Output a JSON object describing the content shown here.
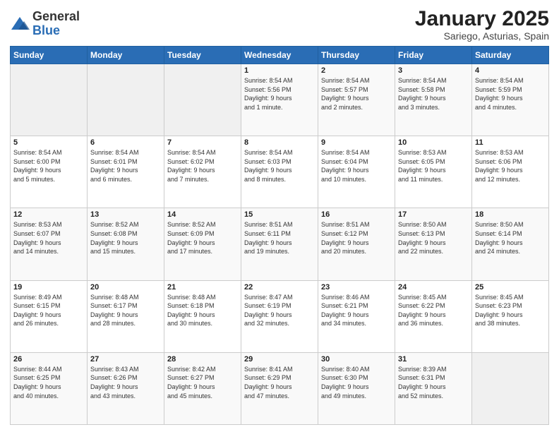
{
  "logo": {
    "general": "General",
    "blue": "Blue"
  },
  "title": "January 2025",
  "subtitle": "Sariego, Asturias, Spain",
  "weekdays": [
    "Sunday",
    "Monday",
    "Tuesday",
    "Wednesday",
    "Thursday",
    "Friday",
    "Saturday"
  ],
  "weeks": [
    [
      {
        "day": "",
        "info": ""
      },
      {
        "day": "",
        "info": ""
      },
      {
        "day": "",
        "info": ""
      },
      {
        "day": "1",
        "info": "Sunrise: 8:54 AM\nSunset: 5:56 PM\nDaylight: 9 hours\nand 1 minute."
      },
      {
        "day": "2",
        "info": "Sunrise: 8:54 AM\nSunset: 5:57 PM\nDaylight: 9 hours\nand 2 minutes."
      },
      {
        "day": "3",
        "info": "Sunrise: 8:54 AM\nSunset: 5:58 PM\nDaylight: 9 hours\nand 3 minutes."
      },
      {
        "day": "4",
        "info": "Sunrise: 8:54 AM\nSunset: 5:59 PM\nDaylight: 9 hours\nand 4 minutes."
      }
    ],
    [
      {
        "day": "5",
        "info": "Sunrise: 8:54 AM\nSunset: 6:00 PM\nDaylight: 9 hours\nand 5 minutes."
      },
      {
        "day": "6",
        "info": "Sunrise: 8:54 AM\nSunset: 6:01 PM\nDaylight: 9 hours\nand 6 minutes."
      },
      {
        "day": "7",
        "info": "Sunrise: 8:54 AM\nSunset: 6:02 PM\nDaylight: 9 hours\nand 7 minutes."
      },
      {
        "day": "8",
        "info": "Sunrise: 8:54 AM\nSunset: 6:03 PM\nDaylight: 9 hours\nand 8 minutes."
      },
      {
        "day": "9",
        "info": "Sunrise: 8:54 AM\nSunset: 6:04 PM\nDaylight: 9 hours\nand 10 minutes."
      },
      {
        "day": "10",
        "info": "Sunrise: 8:53 AM\nSunset: 6:05 PM\nDaylight: 9 hours\nand 11 minutes."
      },
      {
        "day": "11",
        "info": "Sunrise: 8:53 AM\nSunset: 6:06 PM\nDaylight: 9 hours\nand 12 minutes."
      }
    ],
    [
      {
        "day": "12",
        "info": "Sunrise: 8:53 AM\nSunset: 6:07 PM\nDaylight: 9 hours\nand 14 minutes."
      },
      {
        "day": "13",
        "info": "Sunrise: 8:52 AM\nSunset: 6:08 PM\nDaylight: 9 hours\nand 15 minutes."
      },
      {
        "day": "14",
        "info": "Sunrise: 8:52 AM\nSunset: 6:09 PM\nDaylight: 9 hours\nand 17 minutes."
      },
      {
        "day": "15",
        "info": "Sunrise: 8:51 AM\nSunset: 6:11 PM\nDaylight: 9 hours\nand 19 minutes."
      },
      {
        "day": "16",
        "info": "Sunrise: 8:51 AM\nSunset: 6:12 PM\nDaylight: 9 hours\nand 20 minutes."
      },
      {
        "day": "17",
        "info": "Sunrise: 8:50 AM\nSunset: 6:13 PM\nDaylight: 9 hours\nand 22 minutes."
      },
      {
        "day": "18",
        "info": "Sunrise: 8:50 AM\nSunset: 6:14 PM\nDaylight: 9 hours\nand 24 minutes."
      }
    ],
    [
      {
        "day": "19",
        "info": "Sunrise: 8:49 AM\nSunset: 6:15 PM\nDaylight: 9 hours\nand 26 minutes."
      },
      {
        "day": "20",
        "info": "Sunrise: 8:48 AM\nSunset: 6:17 PM\nDaylight: 9 hours\nand 28 minutes."
      },
      {
        "day": "21",
        "info": "Sunrise: 8:48 AM\nSunset: 6:18 PM\nDaylight: 9 hours\nand 30 minutes."
      },
      {
        "day": "22",
        "info": "Sunrise: 8:47 AM\nSunset: 6:19 PM\nDaylight: 9 hours\nand 32 minutes."
      },
      {
        "day": "23",
        "info": "Sunrise: 8:46 AM\nSunset: 6:21 PM\nDaylight: 9 hours\nand 34 minutes."
      },
      {
        "day": "24",
        "info": "Sunrise: 8:45 AM\nSunset: 6:22 PM\nDaylight: 9 hours\nand 36 minutes."
      },
      {
        "day": "25",
        "info": "Sunrise: 8:45 AM\nSunset: 6:23 PM\nDaylight: 9 hours\nand 38 minutes."
      }
    ],
    [
      {
        "day": "26",
        "info": "Sunrise: 8:44 AM\nSunset: 6:25 PM\nDaylight: 9 hours\nand 40 minutes."
      },
      {
        "day": "27",
        "info": "Sunrise: 8:43 AM\nSunset: 6:26 PM\nDaylight: 9 hours\nand 43 minutes."
      },
      {
        "day": "28",
        "info": "Sunrise: 8:42 AM\nSunset: 6:27 PM\nDaylight: 9 hours\nand 45 minutes."
      },
      {
        "day": "29",
        "info": "Sunrise: 8:41 AM\nSunset: 6:29 PM\nDaylight: 9 hours\nand 47 minutes."
      },
      {
        "day": "30",
        "info": "Sunrise: 8:40 AM\nSunset: 6:30 PM\nDaylight: 9 hours\nand 49 minutes."
      },
      {
        "day": "31",
        "info": "Sunrise: 8:39 AM\nSunset: 6:31 PM\nDaylight: 9 hours\nand 52 minutes."
      },
      {
        "day": "",
        "info": ""
      }
    ]
  ]
}
